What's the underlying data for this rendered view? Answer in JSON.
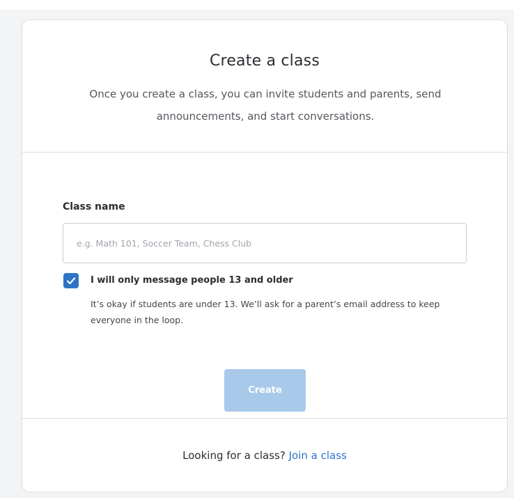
{
  "modal": {
    "title": "Create a class",
    "subtitle": "Once you create a class, you can invite students and parents, send announcements, and start conversations."
  },
  "form": {
    "class_name_label": "Class name",
    "class_name_value": "",
    "class_name_placeholder": "e.g. Math 101, Soccer Team, Chess Club",
    "age_checkbox_checked": true,
    "age_checkbox_label": "I will only message people 13 and older",
    "age_checkbox_help": "It’s okay if students are under 13. We’ll ask for a parent’s email address to keep everyone in the loop.",
    "create_label": "Create",
    "create_enabled": false
  },
  "footer": {
    "prompt": "Looking for a class?",
    "join_link": "Join a class"
  },
  "colors": {
    "accent": "#2d74c6",
    "button_disabled": "#a9c9eb",
    "border": "#dcdde0"
  }
}
